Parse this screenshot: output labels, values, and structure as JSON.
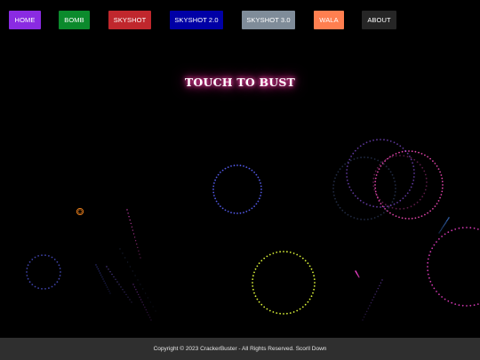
{
  "nav": {
    "items": [
      {
        "label": "HOME",
        "color": "#8a2be2"
      },
      {
        "label": "BOMB",
        "color": "#0b8a2c"
      },
      {
        "label": "SKYSHOT",
        "color": "#c0272d"
      },
      {
        "label": "SKYSHOT 2.0",
        "color": "#0000a6"
      },
      {
        "label": "SKYSHOT 3.0",
        "color": "#7f8c99"
      },
      {
        "label": "WALA",
        "color": "#ff7f50"
      },
      {
        "label": "ABOUT",
        "color": "#262626"
      }
    ]
  },
  "hero": {
    "headline": "TOUCH TO BUST",
    "glow_color": "#ff3fa9"
  },
  "footer": {
    "copyright": "Copyright © 2023 CrackerBuster - All Rights Reserved. Scorll Down"
  },
  "fireworks": {
    "rings": [
      {
        "color": "#5b63ff"
      },
      {
        "color": "#4a4fc8"
      },
      {
        "color": "#ff4fc2"
      },
      {
        "color": "#3d4c7a"
      },
      {
        "color": "#ff45d8"
      },
      {
        "color": "#9b5cff"
      },
      {
        "color": "#e6ff3a"
      },
      {
        "color": "#ff50c8"
      }
    ],
    "spark_color": "#ff8a1f"
  }
}
